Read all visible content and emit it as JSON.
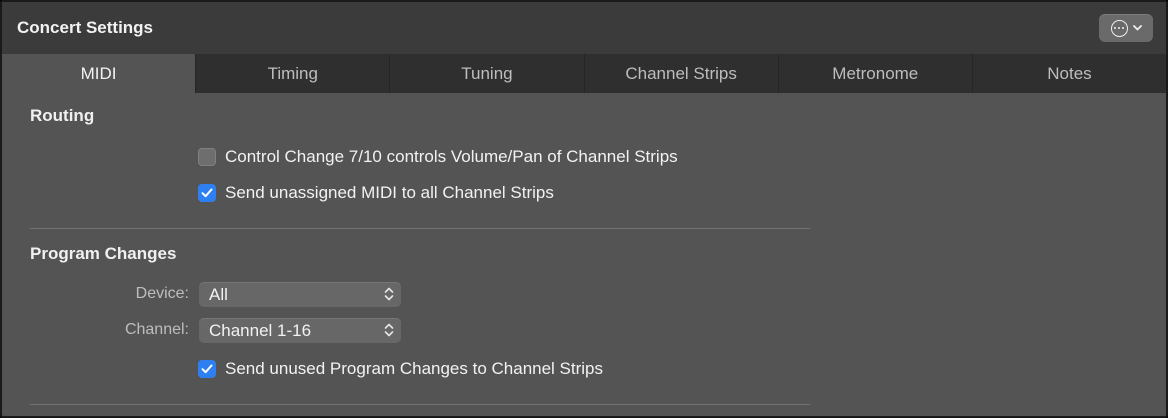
{
  "window": {
    "title": "Concert Settings",
    "action_menu_icon": "ellipsis-circle-icon"
  },
  "tabs": [
    {
      "label": "MIDI",
      "active": true
    },
    {
      "label": "Timing",
      "active": false
    },
    {
      "label": "Tuning",
      "active": false
    },
    {
      "label": "Channel Strips",
      "active": false
    },
    {
      "label": "Metronome",
      "active": false
    },
    {
      "label": "Notes",
      "active": false
    }
  ],
  "routing": {
    "title": "Routing",
    "options": [
      {
        "label": "Control Change 7/10 controls Volume/Pan of Channel Strips",
        "checked": false
      },
      {
        "label": "Send unassigned MIDI to all Channel Strips",
        "checked": true
      }
    ]
  },
  "program_changes": {
    "title": "Program Changes",
    "device": {
      "label": "Device:",
      "value": "All"
    },
    "channel": {
      "label": "Channel:",
      "value": "Channel 1-16"
    },
    "option": {
      "label": "Send unused Program Changes to Channel Strips",
      "checked": true
    }
  },
  "colors": {
    "accent": "#2e7ff2",
    "panel": "#545454",
    "tabbar": "#2f2f2f"
  }
}
